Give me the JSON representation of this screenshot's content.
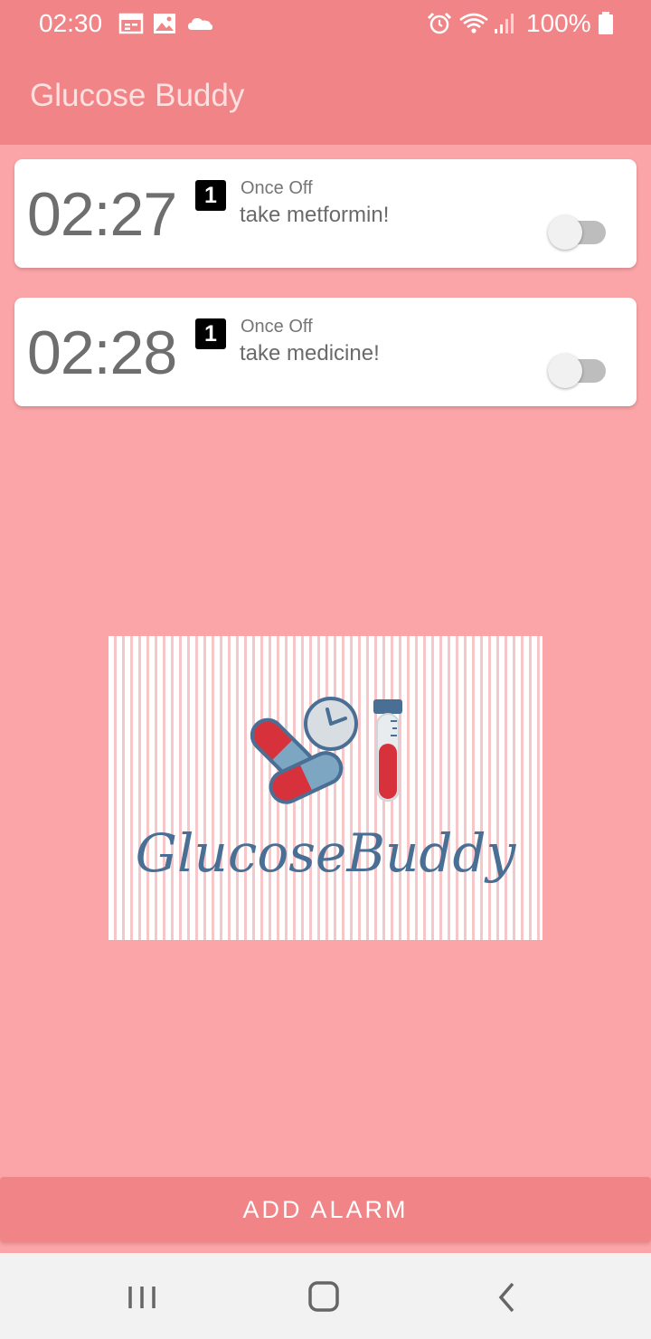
{
  "status_bar": {
    "time": "02:30",
    "battery": "100%",
    "icons": [
      "calendar-icon",
      "image-icon",
      "cloud-icon",
      "alarm-clock-icon",
      "wifi-icon",
      "signal-icon",
      "battery-icon"
    ]
  },
  "app_bar": {
    "title": "Glucose Buddy"
  },
  "alarms": [
    {
      "time": "02:27",
      "badge": "1",
      "repeat": "Once Off",
      "label": "take metformin!",
      "enabled": false
    },
    {
      "time": "02:28",
      "badge": "1",
      "repeat": "Once Off",
      "label": "take medicine!",
      "enabled": false
    }
  ],
  "logo": {
    "text": "GlucoseBuddy",
    "icons": [
      "pill-icon",
      "clock-icon",
      "test-tube-icon"
    ]
  },
  "add_button": {
    "label": "ADD ALARM"
  },
  "nav_bar": {
    "icons": [
      "recent-apps-icon",
      "home-icon",
      "back-icon"
    ]
  },
  "colors": {
    "primary": "#f08487",
    "background": "#fca5a8",
    "logo_blue": "#4a6f95",
    "logo_red": "#d7313b"
  }
}
